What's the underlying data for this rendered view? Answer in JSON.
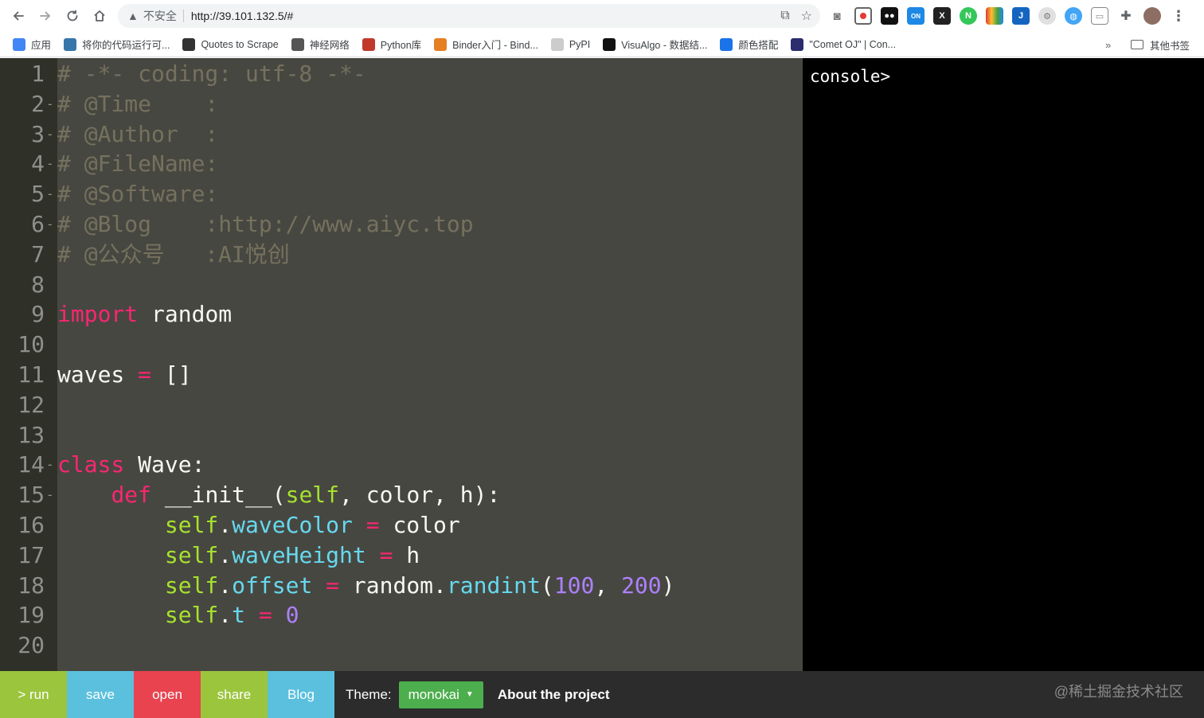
{
  "browser": {
    "security_label": "不安全",
    "url": "http://39.101.132.5/#",
    "bookmarks": [
      {
        "label": "应用",
        "color": "#4285f4"
      },
      {
        "label": "将你的代码运行可...",
        "color": "#3776ab"
      },
      {
        "label": "Quotes to Scrape",
        "color": "#333333"
      },
      {
        "label": "神经网络",
        "color": "#555555"
      },
      {
        "label": "Python库",
        "color": "#c0392b"
      },
      {
        "label": "Binder入门 - Bind...",
        "color": "#e67e22"
      },
      {
        "label": "PyPI",
        "color": "#cccccc"
      },
      {
        "label": "VisuAlgo - 数据结...",
        "color": "#111111"
      },
      {
        "label": "颜色搭配",
        "color": "#1a73e8"
      },
      {
        "label": "\"Comet OJ\" | Con...",
        "color": "#2b2d6e"
      }
    ],
    "bookmarks_more": "»",
    "other_bookmarks": "其他书签"
  },
  "editor": {
    "lines": [
      {
        "n": "1",
        "fold": "",
        "tokens": [
          {
            "t": "# -*- coding: utf-8 -*-",
            "c": "c-comment"
          }
        ]
      },
      {
        "n": "2",
        "fold": "-",
        "tokens": [
          {
            "t": "# @Time    :",
            "c": "c-comment"
          }
        ]
      },
      {
        "n": "3",
        "fold": "-",
        "tokens": [
          {
            "t": "# @Author  :",
            "c": "c-comment"
          }
        ]
      },
      {
        "n": "4",
        "fold": "-",
        "tokens": [
          {
            "t": "# @FileName:",
            "c": "c-comment"
          }
        ]
      },
      {
        "n": "5",
        "fold": "-",
        "tokens": [
          {
            "t": "# @Software:",
            "c": "c-comment"
          }
        ]
      },
      {
        "n": "6",
        "fold": "-",
        "tokens": [
          {
            "t": "# @Blog    :http://www.aiyc.top",
            "c": "c-comment"
          }
        ]
      },
      {
        "n": "7",
        "fold": "",
        "tokens": [
          {
            "t": "# @公众号   :AI悦创",
            "c": "c-comment"
          }
        ]
      },
      {
        "n": "8",
        "fold": "",
        "tokens": []
      },
      {
        "n": "9",
        "fold": "",
        "tokens": [
          {
            "t": "import",
            "c": "c-kw"
          },
          {
            "t": " random",
            "c": ""
          }
        ]
      },
      {
        "n": "10",
        "fold": "",
        "tokens": []
      },
      {
        "n": "11",
        "fold": "",
        "tokens": [
          {
            "t": "waves ",
            "c": ""
          },
          {
            "t": "=",
            "c": "c-kw"
          },
          {
            "t": " []",
            "c": ""
          }
        ]
      },
      {
        "n": "12",
        "fold": "",
        "tokens": []
      },
      {
        "n": "13",
        "fold": "",
        "tokens": []
      },
      {
        "n": "14",
        "fold": "-",
        "tokens": [
          {
            "t": "class",
            "c": "c-kw"
          },
          {
            "t": " Wave:",
            "c": ""
          }
        ]
      },
      {
        "n": "15",
        "fold": "-",
        "tokens": [
          {
            "t": "    ",
            "c": ""
          },
          {
            "t": "def",
            "c": "c-kw"
          },
          {
            "t": " __init__(",
            "c": ""
          },
          {
            "t": "self",
            "c": "c-self"
          },
          {
            "t": ", color, h):",
            "c": ""
          }
        ]
      },
      {
        "n": "16",
        "fold": "",
        "tokens": [
          {
            "t": "        ",
            "c": ""
          },
          {
            "t": "self",
            "c": "c-self"
          },
          {
            "t": ".",
            "c": ""
          },
          {
            "t": "waveColor",
            "c": "c-attr"
          },
          {
            "t": " ",
            "c": ""
          },
          {
            "t": "=",
            "c": "c-kw"
          },
          {
            "t": " color",
            "c": ""
          }
        ]
      },
      {
        "n": "17",
        "fold": "",
        "tokens": [
          {
            "t": "        ",
            "c": ""
          },
          {
            "t": "self",
            "c": "c-self"
          },
          {
            "t": ".",
            "c": ""
          },
          {
            "t": "waveHeight",
            "c": "c-attr"
          },
          {
            "t": " ",
            "c": ""
          },
          {
            "t": "=",
            "c": "c-kw"
          },
          {
            "t": " h",
            "c": ""
          }
        ]
      },
      {
        "n": "18",
        "fold": "",
        "tokens": [
          {
            "t": "        ",
            "c": ""
          },
          {
            "t": "self",
            "c": "c-self"
          },
          {
            "t": ".",
            "c": ""
          },
          {
            "t": "offset",
            "c": "c-attr"
          },
          {
            "t": " ",
            "c": ""
          },
          {
            "t": "=",
            "c": "c-kw"
          },
          {
            "t": " random.",
            "c": ""
          },
          {
            "t": "randint",
            "c": "c-attr"
          },
          {
            "t": "(",
            "c": ""
          },
          {
            "t": "100",
            "c": "c-purple"
          },
          {
            "t": ", ",
            "c": ""
          },
          {
            "t": "200",
            "c": "c-purple"
          },
          {
            "t": ")",
            "c": ""
          }
        ]
      },
      {
        "n": "19",
        "fold": "",
        "tokens": [
          {
            "t": "        ",
            "c": ""
          },
          {
            "t": "self",
            "c": "c-self"
          },
          {
            "t": ".",
            "c": ""
          },
          {
            "t": "t",
            "c": "c-attr"
          },
          {
            "t": " ",
            "c": ""
          },
          {
            "t": "=",
            "c": "c-kw"
          },
          {
            "t": " ",
            "c": ""
          },
          {
            "t": "0",
            "c": "c-purple"
          }
        ]
      },
      {
        "n": "20",
        "fold": "",
        "tokens": []
      }
    ]
  },
  "console": {
    "prompt": "console>"
  },
  "bottombar": {
    "buttons": [
      {
        "label": "> run",
        "color": "#9bc53d"
      },
      {
        "label": "save",
        "color": "#5bc0de"
      },
      {
        "label": "open",
        "color": "#e8434f"
      },
      {
        "label": "share",
        "color": "#9bc53d"
      },
      {
        "label": "Blog",
        "color": "#5bc0de"
      }
    ],
    "theme_label": "Theme:",
    "theme_value": "monokai",
    "about": "About the project",
    "watermark": "@稀土掘金技术社区"
  }
}
